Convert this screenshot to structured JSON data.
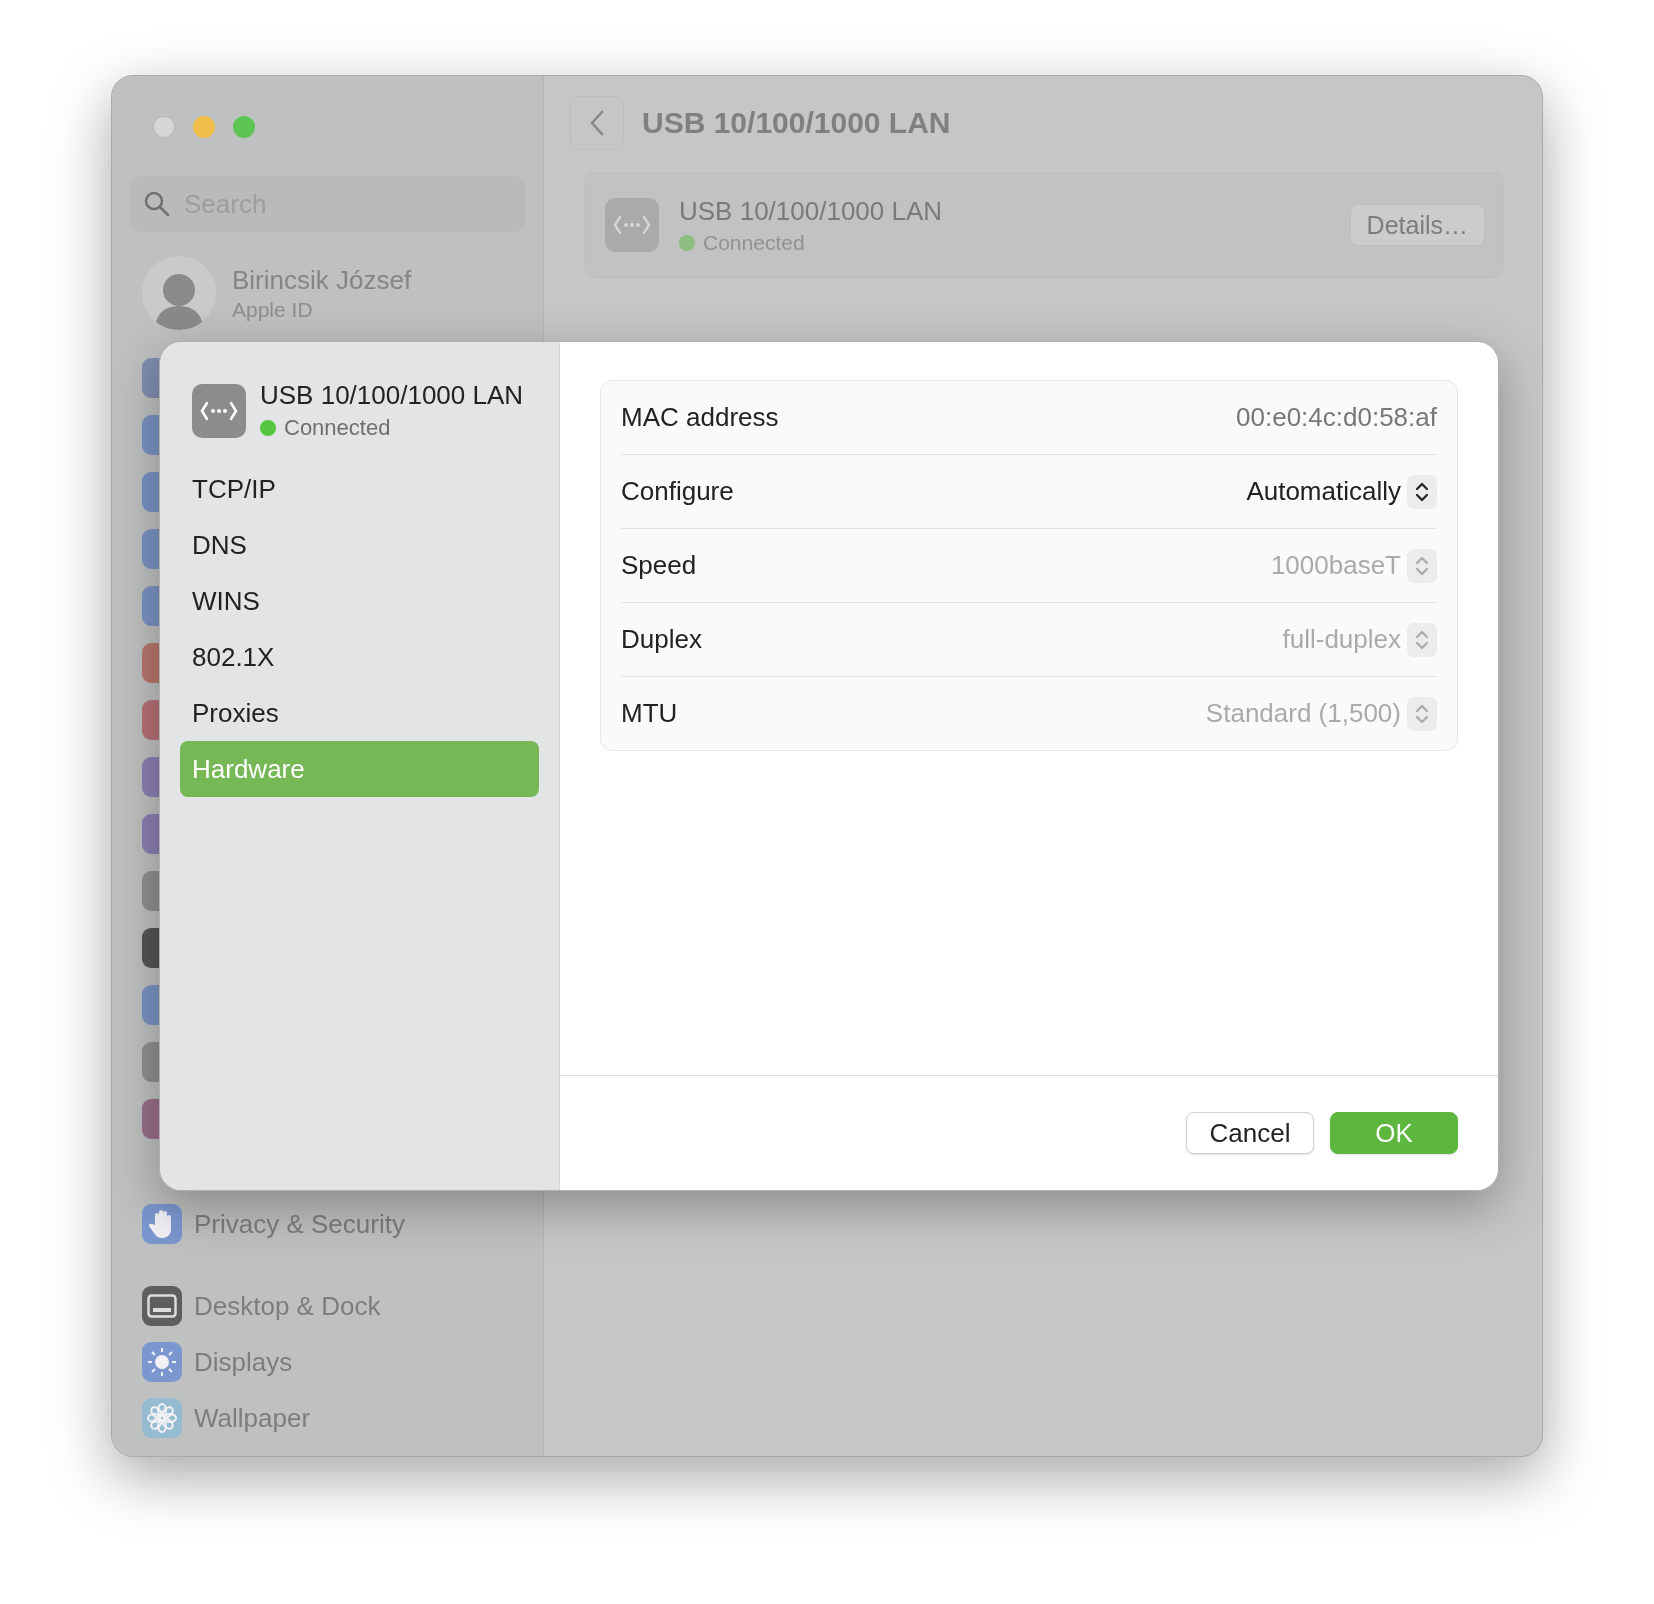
{
  "sidebar": {
    "search": {
      "placeholder": "Search"
    },
    "account": {
      "name": "Birincsik József",
      "subtitle": "Apple ID"
    },
    "items": [
      {
        "label": "Privacy & Security",
        "kind": "hand",
        "group_start": false
      },
      {
        "label": "Desktop & Dock",
        "kind": "desktop",
        "group_start": true
      },
      {
        "label": "Displays",
        "kind": "sun",
        "group_start": false
      },
      {
        "label": "Wallpaper",
        "kind": "flower",
        "group_start": false
      }
    ]
  },
  "header": {
    "title": "USB 10/100/1000 LAN"
  },
  "service_card": {
    "name": "USB 10/100/1000 LAN",
    "status": "Connected",
    "button": "Details…"
  },
  "sheet": {
    "device": {
      "name": "USB 10/100/1000 LAN",
      "status": "Connected"
    },
    "nav": [
      {
        "label": "TCP/IP",
        "selected": false
      },
      {
        "label": "DNS",
        "selected": false
      },
      {
        "label": "WINS",
        "selected": false
      },
      {
        "label": "802.1X",
        "selected": false
      },
      {
        "label": "Proxies",
        "selected": false
      },
      {
        "label": "Hardware",
        "selected": true
      }
    ],
    "rows": [
      {
        "label": "MAC address",
        "value": "00:e0:4c:d0:58:af",
        "kind": "text"
      },
      {
        "label": "Configure",
        "value": "Automatically",
        "kind": "popup",
        "disabled": false
      },
      {
        "label": "Speed",
        "value": "1000baseT",
        "kind": "popup",
        "disabled": true
      },
      {
        "label": "Duplex",
        "value": "full-duplex",
        "kind": "popup",
        "disabled": true
      },
      {
        "label": "MTU",
        "value": "Standard (1,500)",
        "kind": "popup",
        "disabled": true
      }
    ],
    "buttons": {
      "cancel": "Cancel",
      "ok": "OK"
    }
  }
}
